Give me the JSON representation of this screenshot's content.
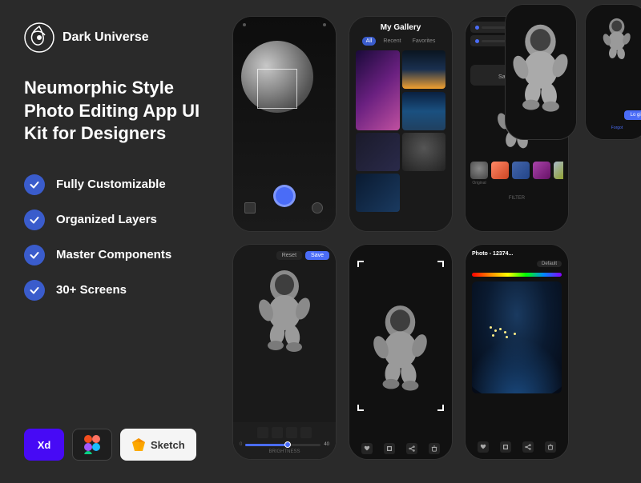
{
  "brand": {
    "name": "Dark Universe",
    "logo_alt": "Dark Universe logo"
  },
  "tagline": "Neumorphic Style Photo Editing App UI Kit for Designers",
  "features": [
    {
      "id": "customizable",
      "text": "Fully Customizable"
    },
    {
      "id": "layers",
      "text": "Organized Layers"
    },
    {
      "id": "components",
      "text": "Master Components"
    },
    {
      "id": "screens",
      "text": "30+ Screens"
    }
  ],
  "tools": [
    {
      "id": "xd",
      "label": "Xd"
    },
    {
      "id": "figma",
      "label": "Figma"
    },
    {
      "id": "sketch",
      "label": "Sketch"
    }
  ],
  "mockups": {
    "gallery_title": "My Gallery",
    "tabs": [
      "All",
      "Recent",
      "Favorites"
    ],
    "photo_name": "Photo - 12374...",
    "filter_label": "FILTER",
    "original_label": "Original",
    "default_label": "Default",
    "brightness_label": "BRIGHTNESS",
    "reset_label": "Reset",
    "save_label": "Save",
    "save_changes_label": "Save Changes"
  },
  "colors": {
    "accent": "#4a6cf7",
    "bg": "#2a2a2a",
    "card_bg": "#1a1a1a"
  }
}
